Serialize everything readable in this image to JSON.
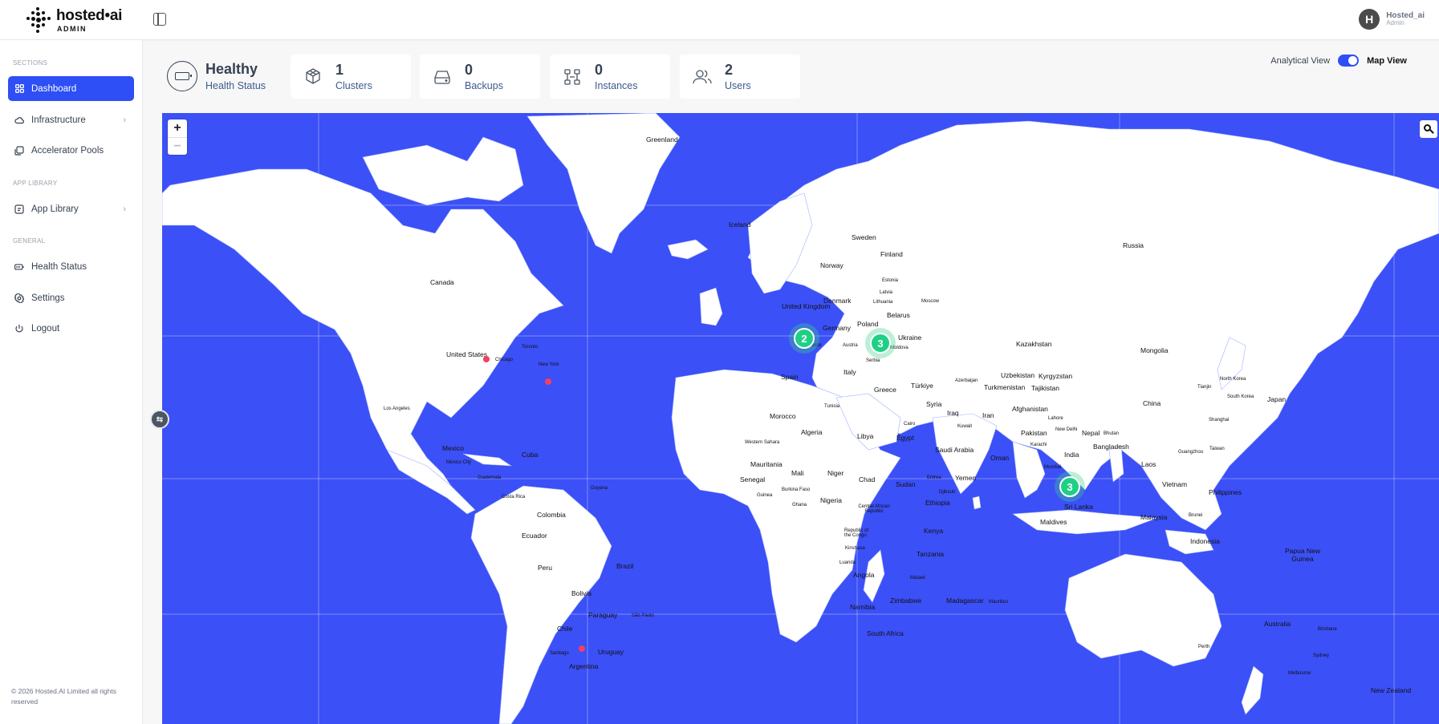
{
  "brand": {
    "name": "hosted•ai",
    "sub": "ADMIN"
  },
  "user": {
    "initial": "H",
    "name": "Hosted_ai",
    "role": "Admin"
  },
  "sidebar": {
    "sections": [
      "SECTIONS",
      "APP LIBRARY",
      "GENERAL"
    ],
    "items": [
      {
        "label": "Dashboard",
        "icon": "grid-icon",
        "active": true
      },
      {
        "label": "Infrastructure",
        "icon": "cloud-icon",
        "chevron": true
      },
      {
        "label": "Accelerator Pools",
        "icon": "layers-icon"
      },
      {
        "label": "App Library",
        "icon": "app-icon",
        "chevron": true
      },
      {
        "label": "Health Status",
        "icon": "battery-icon"
      },
      {
        "label": "Settings",
        "icon": "gear-icon"
      },
      {
        "label": "Logout",
        "icon": "power-icon"
      }
    ],
    "copyright": "© 2026 Hosted.AI Limited all rights reserved"
  },
  "stats": {
    "health": {
      "title": "Healthy",
      "label": "Health Status"
    },
    "cards": [
      {
        "value": "1",
        "label": "Clusters",
        "icon": "cube-icon"
      },
      {
        "value": "0",
        "label": "Backups",
        "icon": "drive-icon"
      },
      {
        "value": "0",
        "label": "Instances",
        "icon": "network-icon"
      },
      {
        "value": "2",
        "label": "Users",
        "icon": "users-icon"
      }
    ]
  },
  "view": {
    "left": "Analytical View",
    "right": "Map View",
    "map_view_on": true
  },
  "map": {
    "zoom_in": "+",
    "zoom_out": "−",
    "clusters": [
      "2",
      "3",
      "3"
    ],
    "labels": {
      "greenland": "Greenland",
      "iceland": "Iceland",
      "russia": "Russia",
      "canada": "Canada",
      "united_states": "United States",
      "mexico": "Mexico",
      "cuba": "Cuba",
      "colombia": "Colombia",
      "ecuador": "Ecuador",
      "peru": "Peru",
      "bolivia": "Bolivia",
      "brazil": "Brazil",
      "paraguay": "Paraguay",
      "chile": "Chile",
      "argentina": "Argentina",
      "uruguay": "Uruguay",
      "guyana": "Guyana",
      "costa_rica": "Costa Rica",
      "guatemala": "Guatemala",
      "sweden": "Sweden",
      "finland": "Finland",
      "norway": "Norway",
      "denmark": "Denmark",
      "united_kingdom": "United Kingdom",
      "germany": "Germany",
      "poland": "Poland",
      "belarus": "Belarus",
      "ukraine": "Ukraine",
      "latvia": "Latvia",
      "lithuania": "Lithuania",
      "estonia": "Estonia",
      "moldova": "Moldova",
      "austria": "Austria",
      "serbia": "Serbia",
      "italy": "Italy",
      "spain": "Spain",
      "greece": "Greece",
      "turkiye": "Türkiye",
      "syria": "Syria",
      "iraq": "Iraq",
      "iran": "Iran",
      "kuwait": "Kuwait",
      "saudi_arabia": "Saudi Arabia",
      "oman": "Oman",
      "yemen": "Yemen",
      "egypt": "Egypt",
      "libya": "Libya",
      "algeria": "Algeria",
      "tunisia": "Tunisia",
      "morocco": "Morocco",
      "western_sahara": "Western Sahara",
      "mauritania": "Mauritania",
      "mali": "Mali",
      "niger": "Niger",
      "chad": "Chad",
      "sudan": "Sudan",
      "eritrea": "Eritrea",
      "djibouti": "Djibouti",
      "ethiopia": "Ethiopia",
      "senegal": "Senegal",
      "guinea": "Guinea",
      "burkina_faso": "Burkina Faso",
      "ghana": "Ghana",
      "nigeria": "Nigeria",
      "car": "Central African Republic",
      "kenya": "Kenya",
      "tanzania": "Tanzania",
      "congo": "Republic of the Congo",
      "kinshasa": "Kinshasa",
      "luanda": "Luanda",
      "angola": "Angola",
      "namibia": "Namibia",
      "zimbabwe": "Zimbabwe",
      "malawi": "Malawi",
      "south_africa": "South Africa",
      "madagascar": "Madagascar",
      "mauritius": "Mauritius",
      "kazakhstan": "Kazakhstan",
      "uzbekistan": "Uzbekistan",
      "kyrgyzstan": "Kyrgyzstan",
      "tajikistan": "Tajikistan",
      "turkmenistan": "Turkmenistan",
      "azerbaijan": "Azerbaijan",
      "afghanistan": "Afghanistan",
      "pakistan": "Pakistan",
      "india": "India",
      "nepal": "Nepal",
      "bhutan": "Bhutan",
      "bangladesh": "Bangladesh",
      "sri_lanka": "Sri Lanka",
      "maldives": "Maldives",
      "mongolia": "Mongolia",
      "china": "China",
      "north_korea": "North Korea",
      "south_korea": "South Korea",
      "japan": "Japan",
      "laos": "Laos",
      "vietnam": "Vietnam",
      "philippines": "Philippines",
      "malaysia": "Malaysia",
      "brunei": "Brunei",
      "indonesia": "Indonesia",
      "papua": "Papua New Guinea",
      "australia": "Australia",
      "new_zealand": "New Zealand",
      "moscow": "Moscow",
      "chicago": "Chicago",
      "toronto": "Toronto",
      "new_york": "New York",
      "los_angeles": "Los Angeles",
      "mexico_city": "Mexico City",
      "santiago": "Santiago",
      "sao_paulo": "São Paulo",
      "lahore": "Lahore",
      "new_delhi": "New Delhi",
      "karachi": "Karachi",
      "mumbai": "Mumbai",
      "shanghai": "Shanghai",
      "guangzhou": "Guangzhou",
      "taiwan": "Taiwan",
      "tianjin": "Tianjin",
      "brisbane": "Brisbane",
      "sydney": "Sydney",
      "melbourne": "Melbourne",
      "perth": "Perth",
      "cairo": "Cairo",
      "france": "France"
    }
  },
  "colors": {
    "accent": "#2d4ff5",
    "ocean": "#3b50f6",
    "land": "#ffffff",
    "cluster": "#1fcf86",
    "pin": "#f43f5e"
  }
}
